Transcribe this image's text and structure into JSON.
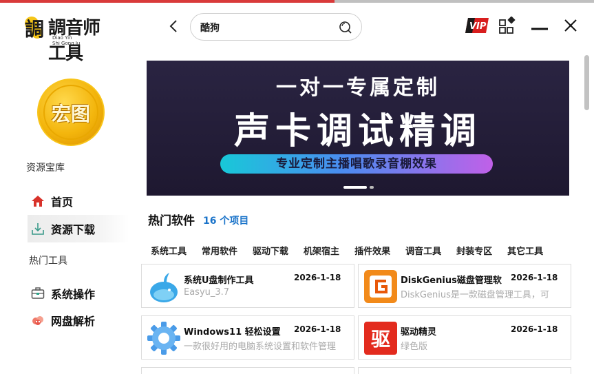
{
  "logo": {
    "cn": "調音师工具",
    "py1": "Diao Yin",
    "py2": "Shi Gong Ju"
  },
  "search": {
    "value": "酷狗"
  },
  "colors": {
    "accent": "#1a73c9",
    "brand_red": "#d93a3a",
    "vip": "#d81e1e"
  },
  "sidebar": {
    "avatar_text": "宏图",
    "section1": "资源宝库",
    "items": [
      {
        "label": "首页",
        "icon": "home-icon"
      },
      {
        "label": "资源下载",
        "icon": "download-icon"
      }
    ],
    "section2": "热门工具",
    "items2": [
      {
        "label": "系统操作",
        "icon": "toolbox-icon"
      },
      {
        "label": "网盘解析",
        "icon": "cloud-icon"
      }
    ]
  },
  "banner": {
    "line1": "一对一专属定制",
    "line2": "声卡调试精调",
    "pill": "专业定制主播唱歌录音棚效果"
  },
  "hot": {
    "title": "热门软件",
    "count": "16 个项目"
  },
  "categories": [
    "系统工具",
    "常用软件",
    "驱动下载",
    "机架宿主",
    "插件效果",
    "调音工具",
    "封装专区",
    "其它工具"
  ],
  "cards": [
    {
      "name": "系统U盘制作工具",
      "date": "2026-1-18",
      "desc": "Easyu_3.7",
      "icon": "whale-icon"
    },
    {
      "name": "DiskGenius磁盘管理软",
      "date": "2026-1-18",
      "desc": "DiskGenius是一款磁盘管理工具，可",
      "icon": "diskgenius-icon"
    },
    {
      "name": "Windows11 轻松设置",
      "date": "2026-1-18",
      "desc": "一款很好用的电脑系统设置和软件管理",
      "icon": "gear-icon"
    },
    {
      "name": "驱动精灵",
      "date": "2026-1-18",
      "desc": "绿色版",
      "icon": "drive-genius-icon",
      "icon_text": "驱"
    }
  ]
}
